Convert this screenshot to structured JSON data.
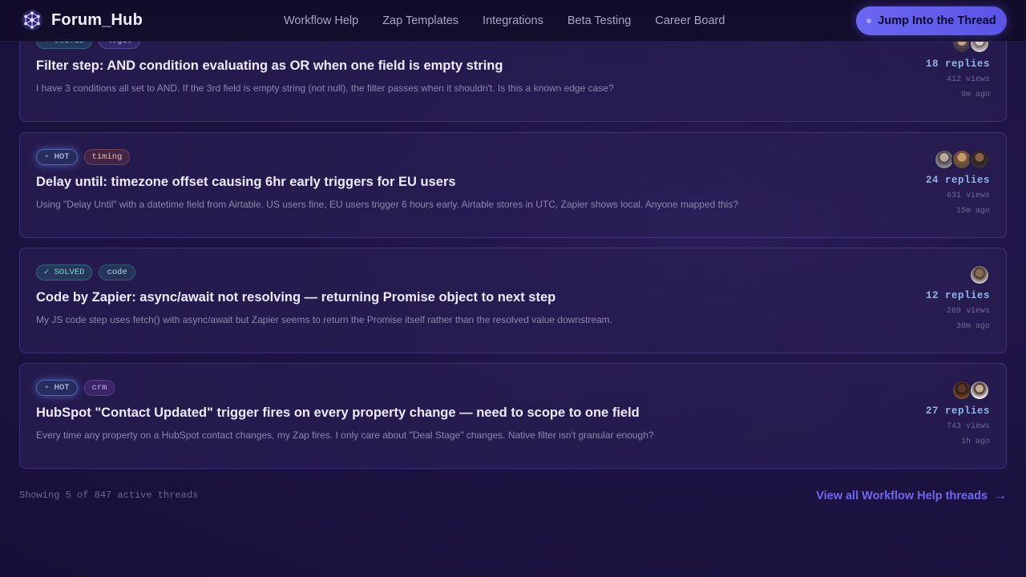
{
  "navbar": {
    "brand": "Forum_Hub",
    "links": [
      "Workflow Help",
      "Zap Templates",
      "Integrations",
      "Beta Testing",
      "Career Board"
    ],
    "cta_label": "Jump Into the Thread"
  },
  "threads": [
    {
      "tags": [
        {
          "label": "✓ SOLVED",
          "kind": "solved"
        },
        {
          "label": "logic",
          "kind": "logic"
        }
      ],
      "title": "Filter step: AND condition evaluating as OR when one field is empty string",
      "excerpt": "I have 3 conditions all set to AND. If the 3rd field is empty string (not null), the filter passes when it shouldn't. Is this a known edge case?",
      "replies": "18 replies",
      "views": "412 views",
      "ago": "9m ago",
      "avatars": [
        "#c9a48a",
        "#d9d2cc"
      ]
    },
    {
      "tags": [
        {
          "label": "▫ HOT",
          "kind": "hot"
        },
        {
          "label": "timing",
          "kind": "timing"
        }
      ],
      "title": "Delay until: timezone offset causing 6hr early triggers for EU users",
      "excerpt": "Using \"Delay Until\" with a datetime field from Airtable. US users fine, EU users trigger 6 hours early. Airtable stores in UTC, Zapier shows local. Anyone mapped this?",
      "replies": "24 replies",
      "views": "631 views",
      "ago": "15m ago",
      "avatars": [
        "#b8a89a",
        "#c49a6c",
        "#6b4e3a"
      ]
    },
    {
      "tags": [
        {
          "label": "✓ SOLVED",
          "kind": "solved"
        },
        {
          "label": "code",
          "kind": "code"
        }
      ],
      "title": "Code by Zapier: async/await not resolving — returning Promise object to next step",
      "excerpt": "My JS code step uses fetch() with async/await but Zapier seems to return the Promise itself rather than the resolved value downstream.",
      "replies": "12 replies",
      "views": "289 views",
      "ago": "38m ago",
      "avatars": [
        "#8a6a52"
      ]
    },
    {
      "tags": [
        {
          "label": "▫ HOT",
          "kind": "hot"
        },
        {
          "label": "crm",
          "kind": "crm"
        }
      ],
      "title": "HubSpot \"Contact Updated\" trigger fires on every property change — need to scope to one field",
      "excerpt": "Every time any property on a HubSpot contact changes, my Zap fires. I only care about \"Deal Stage\" changes. Native filter isn't granular enough?",
      "replies": "27 replies",
      "views": "743 views",
      "ago": "1h ago",
      "avatars": [
        "#5a3a2a",
        "#e8e4e0"
      ]
    }
  ],
  "footer": {
    "count_text": "Showing 5 of 847 active threads",
    "link_label": "View all Workflow Help threads"
  },
  "colors": {
    "accent": "#6a66f2",
    "background": "#1e1444"
  }
}
